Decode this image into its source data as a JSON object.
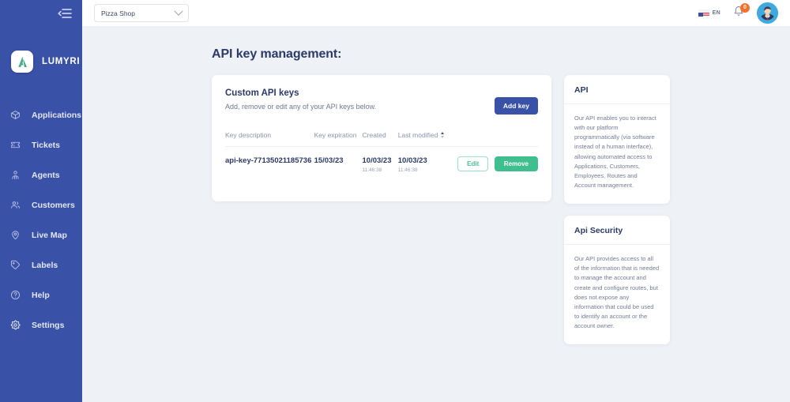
{
  "sidebar": {
    "collapse_icon": "collapse-menu-icon",
    "brand": {
      "name": "LUMYRI",
      "logo_icon": "lumyri-logo-icon"
    },
    "items": [
      {
        "label": "Applications",
        "icon": "box-icon"
      },
      {
        "label": "Tickets",
        "icon": "ticket-icon"
      },
      {
        "label": "Agents",
        "icon": "agent-icon"
      },
      {
        "label": "Customers",
        "icon": "customers-icon"
      },
      {
        "label": "Live Map",
        "icon": "map-pin-icon"
      },
      {
        "label": "Labels",
        "icon": "tag-icon"
      },
      {
        "label": "Help",
        "icon": "question-circle-icon"
      },
      {
        "label": "Settings",
        "icon": "gear-icon"
      }
    ]
  },
  "topbar": {
    "shop_selector": {
      "value": "Pizza Shop",
      "icon": "chevron-down-icon"
    },
    "language": {
      "label": "EN",
      "icon": "us-flag-icon"
    },
    "notifications": {
      "count": "0",
      "icon": "bell-icon"
    },
    "avatar": {
      "icon": "user-avatar"
    }
  },
  "page": {
    "title": "API key management:"
  },
  "api_keys_card": {
    "title": "Custom API keys",
    "subtitle": "Add, remove or edit any of your API keys below.",
    "add_key_label": "Add key",
    "columns": [
      "Key description",
      "Key expiration",
      "Created",
      "Last modified"
    ],
    "sort_column": "Last modified",
    "rows": [
      {
        "key_description": "api-key-77135021185736",
        "key_expiration": "15/03/23",
        "created_date": "10/03/23",
        "created_time": "11:46:38",
        "modified_date": "10/03/23",
        "modified_time": "11:46:38",
        "edit_label": "Edit",
        "remove_label": "Remove"
      }
    ]
  },
  "info_cards": [
    {
      "title": "API",
      "body": "Our API enables you to interact with our platform programmatically (via software instead of a human interface), allowing automated access to Applications, Customers, Employees, Routes and Account management."
    },
    {
      "title": "Api Security",
      "body": "Our API provides access to all of the information that is needed to manage the account and create and configure routes, but does not expose any information that could be used to identify an account or the account owner."
    }
  ],
  "colors": {
    "sidebar": "#3a51a8",
    "primary": "#3a51a8",
    "success": "#3fbf8f",
    "badge": "#f4712b",
    "page_bg": "#eef1f6"
  }
}
